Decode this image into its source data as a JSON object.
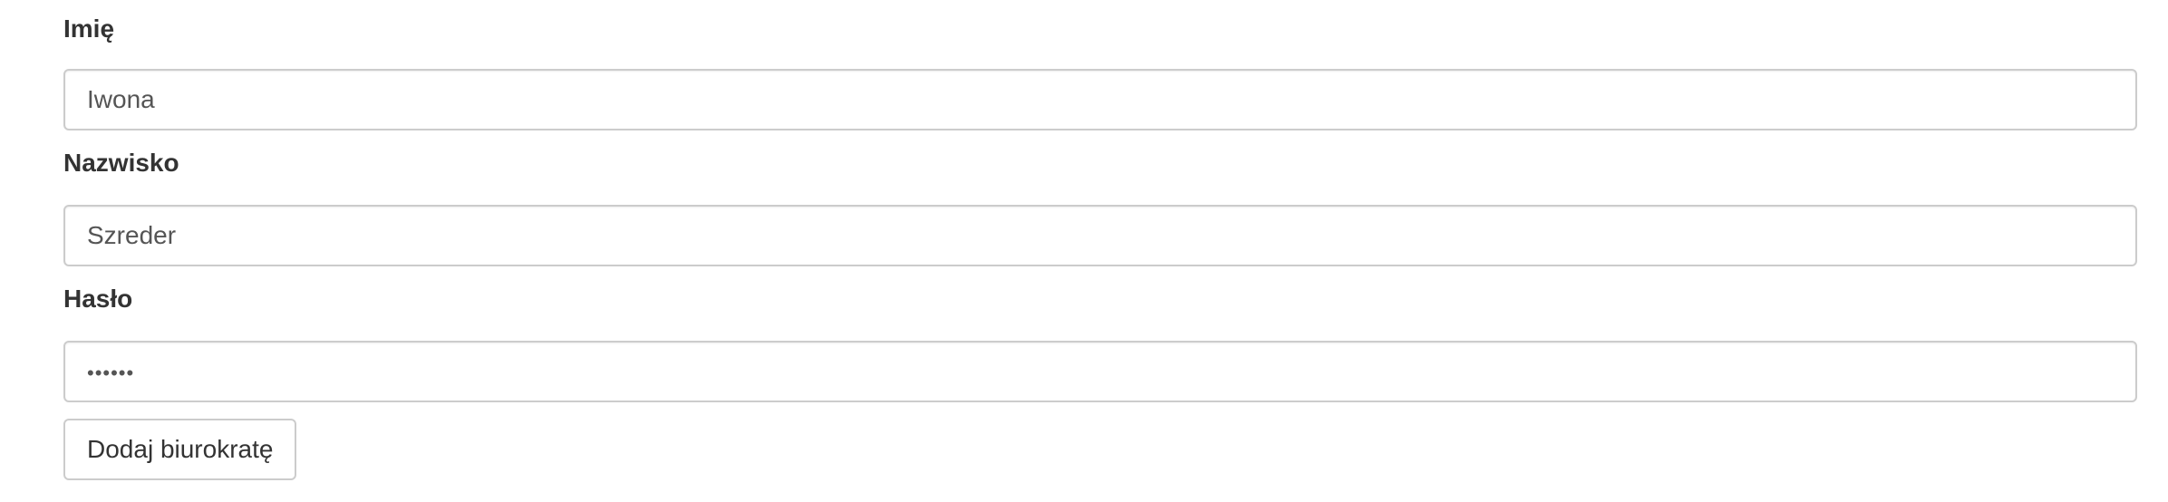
{
  "form": {
    "first_name": {
      "label": "Imię",
      "value": "Iwona"
    },
    "last_name": {
      "label": "Nazwisko",
      "value": "Szreder"
    },
    "password": {
      "label": "Hasło",
      "value": "••••••"
    },
    "submit_label": "Dodaj biurokratę"
  }
}
